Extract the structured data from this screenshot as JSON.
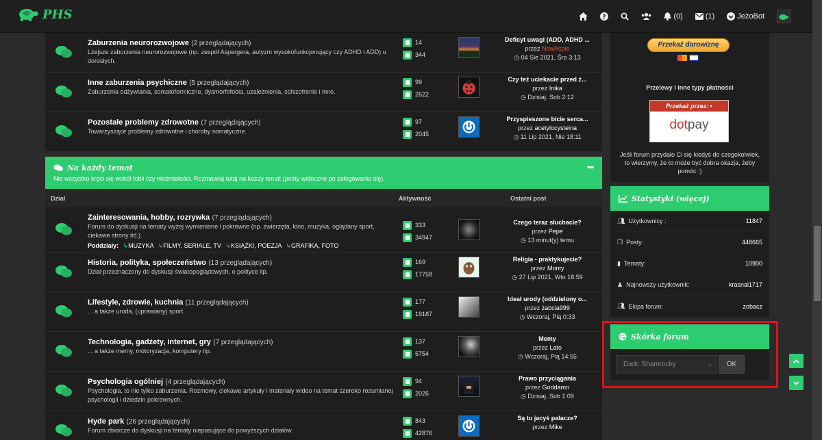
{
  "header": {
    "logo_text": "PHS",
    "notifications_count": "(0)",
    "messages_count": "(1)",
    "username": "JeżoBot"
  },
  "top_rows": [
    {
      "title": "Zaburzenia neurorozwojowe",
      "viewers": "(2 przeglądających)",
      "desc": "Lżejsze zaburzenia neurorozwojowe (np. zespół Aspergera, autyzm wysokofunkcjonujący czy ADHD i ADD) u dorosłych.",
      "topics": "14",
      "posts": "344",
      "lp_title": "Deficyt uwagi (ADD, ADHD ...",
      "lp_by_prefix": "przez",
      "lp_by": "NewAspie",
      "lp_date": "04 Sie 2021, Śro 3:13"
    },
    {
      "title": "Inne zaburzenia psychiczne",
      "viewers": "(5 przeglądających)",
      "desc": "Zaburzenia odżywiania, somatoformiczne, dysmorfofobia, uzależnienia, schizofrenie i inne.",
      "topics": "99",
      "posts": "2622",
      "lp_title": "Czy też uciekacie przed ż...",
      "lp_by_prefix": "przez",
      "lp_by": "Inika",
      "lp_date": "Dzisiaj, Sob 2:12"
    },
    {
      "title": "Pozostałe problemy zdrowotne",
      "viewers": "(7 przeglądających)",
      "desc": "Towarzyszące problemy zdrowotne i choroby somatyczne.",
      "topics": "97",
      "posts": "2045",
      "lp_title": "Przyspieszone bicie serca...",
      "lp_by_prefix": "przez",
      "lp_by": "acetylocysteina",
      "lp_date": "11 Lip 2021, Nie 18:11"
    }
  ],
  "category": {
    "title": "Na każdy temat",
    "desc": "Nie wszystko kręci się wokół fobii czy nieśmiałości. Rozmawiaj tutaj na każdy temat (posty widoczne po zalogowaniu się).",
    "col_forum": "Dział",
    "col_activity": "Aktywność",
    "col_last": "Ostatni post"
  },
  "rows": [
    {
      "title": "Zainteresowania, hobby, rozrywka",
      "viewers": "(7 przeglądających)",
      "desc": "Forum do dyskusji na tematy wyżej wymienione i pokrewne (np. zwierzęta, kino, muzyka, oglądany sport, ciekawe strony itd.).",
      "subforums_label": "Poddziały:",
      "subforums": [
        "MUZYKA",
        "FILMY, SERIALE, TV",
        "KSIĄŻKI, POEZJA",
        "GRAFIKA, FOTO"
      ],
      "topics": "333",
      "posts": "34947",
      "lp_title": "Czego teraz słuchacie?",
      "lp_by_prefix": "przez",
      "lp_by": "Pepe",
      "lp_date": "13 minut(y) temu"
    },
    {
      "title": "Historia, polityka, społeczeństwo",
      "viewers": "(13 przeglądających)",
      "desc": "Dział przeznaczony do dyskusji światopoglądowych, o polityce itp.",
      "topics": "169",
      "posts": "17758",
      "lp_title": "Religia - praktykujecie?",
      "lp_by_prefix": "przez",
      "lp_by": "Monty",
      "lp_date": "27 Lip 2021, Wto 18:59"
    },
    {
      "title": "Lifestyle, zdrowie, kuchnia",
      "viewers": "(11 przeglądających)",
      "desc": "... a także uroda, (uprawiany) sport.",
      "topics": "177",
      "posts": "19187",
      "lp_title": "Ideał urody (oddzielony o...",
      "lp_by_prefix": "przez",
      "lp_by": "żabcia999",
      "lp_date": "Wczoraj, Pią 0:33"
    },
    {
      "title": "Technologia, gadżety, internet, gry",
      "viewers": "(7 przeglądających)",
      "desc": "... a także memy, motoryzacja, komputery itp.",
      "topics": "137",
      "posts": "5754",
      "lp_title": "Memy",
      "lp_by_prefix": "przez",
      "lp_by": "Lato",
      "lp_date": "Wczoraj, Pią 14:55"
    },
    {
      "title": "Psychologia ogólniej",
      "viewers": "(4 przeglądających)",
      "desc": "Psychologia, to nie tylko zaburzenia. Rozmowy, ciekawe artykuły i materiały wideo na temat szeroko rozumianej psychologii i dziedzin pokrewnych.",
      "topics": "94",
      "posts": "2026",
      "lp_title": "Prawo przyciągania",
      "lp_by_prefix": "przez",
      "lp_by": "Goddamn",
      "lp_date": "Dzisiaj, Sob 1:09"
    },
    {
      "title": "Hyde park",
      "viewers": "(26 przeglądających)",
      "desc": "Forum zbiorcze do dyskusji na tematy niepasujące do powyższych działów.",
      "topics": "843",
      "posts": "42876",
      "lp_title": "Są tu jacyś palacze?",
      "lp_by_prefix": "przez",
      "lp_by": "Mike",
      "lp_date": ""
    }
  ],
  "sidebar": {
    "donate_button": "Przekaż darowiznę",
    "transfer_label": "Przelewy i inne typy płatności",
    "dotpay_header": "Przekaż przez:",
    "dotpay_logo_a": "dot",
    "dotpay_logo_b": "pay",
    "note": "Jeśli forum przydało Ci się kiedyś do czegokolwiek, to wierzymy, że to może być dobra okazja, żeby pomóc :)",
    "stats_title": "Statystyki (więcej)",
    "stats": [
      {
        "label": "Użytkownicy :",
        "value": "11847"
      },
      {
        "label": "Posty:",
        "value": "448665"
      },
      {
        "label": "Tematy:",
        "value": "10900"
      },
      {
        "label": "Najnowszy użytkownik:",
        "value": "krasnal1717"
      },
      {
        "label": "Ekipa forum:",
        "value": "zobacz"
      }
    ],
    "skin_title": "Skórka forum",
    "skin_selected": "Dark: Shamrocky",
    "ok_label": "OK"
  },
  "colors": {
    "accent": "#2ecc71",
    "highlight": "#e0101a"
  }
}
